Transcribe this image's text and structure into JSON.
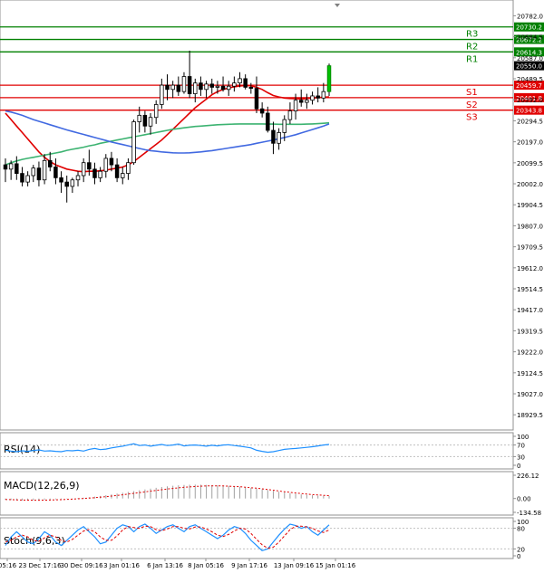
{
  "chart_data": [
    {
      "type": "candlestick",
      "panel": "price",
      "y_ticks": [
        "20782.0",
        "20684.5",
        "20587.0",
        "20489.5",
        "20392.0",
        "20294.5",
        "20197.0",
        "20099.5",
        "20002.0",
        "19904.5",
        "19807.0",
        "19709.5",
        "19612.0",
        "19514.5",
        "19417.0",
        "19319.5",
        "19222.0",
        "19124.5",
        "19027.0",
        "18929.5"
      ],
      "ylim": [
        18880,
        20830
      ],
      "x_ticks": [
        "05:16",
        "23 Dec 17:16",
        "30 Dec 09:16",
        "3 Jan 01:16",
        "6 Jan 13:16",
        "8 Jan 05:16",
        "9 Jan 17:16",
        "13 Jan 09:16",
        "15 Jan 01:16"
      ],
      "levels": [
        {
          "label": "R3",
          "value": 20730.2,
          "price_label": "20730.2",
          "color": "#008000"
        },
        {
          "label": "R2",
          "value": 20672.2,
          "price_label": "20672.2",
          "color": "#008000"
        },
        {
          "label": "R1",
          "value": 20614.3,
          "price_label": "20614.3",
          "color": "#008000"
        },
        {
          "label": "S1",
          "value": 20459.7,
          "price_label": "20459.7",
          "color": "#e00000"
        },
        {
          "label": "S2",
          "value": 20401.8,
          "price_label": "20401.8",
          "color": "#e00000"
        },
        {
          "label": "S3",
          "value": 20343.8,
          "price_label": "20343.8",
          "color": "#e00000"
        }
      ],
      "current_price": 20550.0,
      "current_price_label": "20550.0",
      "candles": [
        [
          20090,
          20120,
          20010,
          20070
        ],
        [
          20070,
          20110,
          20020,
          20095
        ],
        [
          20095,
          20130,
          20020,
          20050
        ],
        [
          20050,
          20080,
          19990,
          20010
        ],
        [
          20010,
          20060,
          19990,
          20040
        ],
        [
          20040,
          20090,
          20010,
          20075
        ],
        [
          20075,
          20105,
          19990,
          20020
        ],
        [
          20020,
          20140,
          20000,
          20110
        ],
        [
          20110,
          20150,
          20060,
          20080
        ],
        [
          20080,
          20120,
          20000,
          20030
        ],
        [
          20030,
          20060,
          19960,
          20010
        ],
        [
          20010,
          20040,
          19915,
          19990
        ],
        [
          19990,
          20030,
          19960,
          20020
        ],
        [
          20020,
          20060,
          19990,
          20040
        ],
        [
          20040,
          20120,
          20010,
          20100
        ],
        [
          20100,
          20160,
          20040,
          20070
        ],
        [
          20070,
          20100,
          20000,
          20030
        ],
        [
          20030,
          20080,
          20010,
          20060
        ],
        [
          20060,
          20140,
          20030,
          20120
        ],
        [
          20120,
          20150,
          20060,
          20090
        ],
        [
          20090,
          20120,
          20010,
          20030
        ],
        [
          20030,
          20080,
          20000,
          20050
        ],
        [
          20050,
          20120,
          20020,
          20100
        ],
        [
          20100,
          20300,
          20090,
          20290
        ],
        [
          20290,
          20360,
          20240,
          20320
        ],
        [
          20320,
          20340,
          20240,
          20270
        ],
        [
          20270,
          20330,
          20230,
          20310
        ],
        [
          20310,
          20390,
          20280,
          20370
        ],
        [
          20370,
          20490,
          20350,
          20460
        ],
        [
          20460,
          20510,
          20390,
          20440
        ],
        [
          20440,
          20480,
          20400,
          20460
        ],
        [
          20460,
          20500,
          20410,
          20430
        ],
        [
          20430,
          20520,
          20420,
          20500
        ],
        [
          20500,
          20620,
          20400,
          20420
        ],
        [
          20420,
          20490,
          20380,
          20470
        ],
        [
          20470,
          20500,
          20410,
          20440
        ],
        [
          20440,
          20480,
          20400,
          20465
        ],
        [
          20465,
          20490,
          20420,
          20450
        ],
        [
          20450,
          20480,
          20420,
          20455
        ],
        [
          20455,
          20500,
          20430,
          20440
        ],
        [
          20440,
          20480,
          20410,
          20455
        ],
        [
          20455,
          20500,
          20430,
          20470
        ],
        [
          20470,
          20520,
          20450,
          20490
        ],
        [
          20490,
          20510,
          20440,
          20450
        ],
        [
          20450,
          20470,
          20420,
          20445
        ],
        [
          20445,
          20500,
          20330,
          20350
        ],
        [
          20350,
          20380,
          20310,
          20330
        ],
        [
          20330,
          20360,
          20240,
          20250
        ],
        [
          20250,
          20290,
          20140,
          20190
        ],
        [
          20190,
          20260,
          20160,
          20240
        ],
        [
          20240,
          20320,
          20200,
          20300
        ],
        [
          20300,
          20380,
          20280,
          20340
        ],
        [
          20340,
          20420,
          20300,
          20390
        ],
        [
          20390,
          20440,
          20360,
          20380
        ],
        [
          20380,
          20420,
          20350,
          20390
        ],
        [
          20390,
          20430,
          20370,
          20410
        ],
        [
          20410,
          20450,
          20380,
          20400
        ],
        [
          20400,
          20470,
          20380,
          20430
        ],
        [
          20430,
          20560,
          20410,
          20550
        ]
      ],
      "ma_series": [
        {
          "color": "#e00000",
          "values": [
            20330,
            20300,
            20270,
            20240,
            20210,
            20180,
            20150,
            20125,
            20105,
            20090,
            20080,
            20070,
            20065,
            20060,
            20058,
            20060,
            20060,
            20062,
            20065,
            20070,
            20075,
            20080,
            20090,
            20105,
            20125,
            20145,
            20165,
            20185,
            20205,
            20230,
            20255,
            20280,
            20305,
            20330,
            20355,
            20375,
            20395,
            20415,
            20430,
            20440,
            20447,
            20452,
            20456,
            20458,
            20457,
            20450,
            20440,
            20425,
            20412,
            20405,
            20400,
            20398,
            20397,
            20396,
            20398,
            20400,
            20402,
            20404,
            20405
          ]
        },
        {
          "color": "#3cb371",
          "values": [
            20090,
            20100,
            20108,
            20115,
            20120,
            20125,
            20130,
            20135,
            20140,
            20145,
            20150,
            20157,
            20162,
            20167,
            20172,
            20178,
            20183,
            20190,
            20195,
            20200,
            20205,
            20210,
            20215,
            20220,
            20225,
            20230,
            20235,
            20240,
            20245,
            20250,
            20255,
            20258,
            20262,
            20265,
            20268,
            20270,
            20272,
            20274,
            20276,
            20277,
            20278,
            20279,
            20280,
            20280,
            20280,
            20280,
            20280,
            20279,
            20279,
            20278,
            20278,
            20278,
            20278,
            20278,
            20279,
            20280,
            20281,
            20283,
            20285
          ]
        },
        {
          "color": "#4169e1",
          "values": [
            20340,
            20335,
            20328,
            20320,
            20310,
            20300,
            20292,
            20284,
            20276,
            20268,
            20260,
            20252,
            20245,
            20238,
            20231,
            20224,
            20217,
            20210,
            20203,
            20196,
            20190,
            20184,
            20178,
            20172,
            20166,
            20160,
            20156,
            20153,
            20150,
            20148,
            20146,
            20145,
            20145,
            20146,
            20148,
            20150,
            20153,
            20156,
            20160,
            20164,
            20168,
            20172,
            20176,
            20180,
            20184,
            20190,
            20195,
            20200,
            20205,
            20211,
            20217,
            20223,
            20230,
            20238,
            20246,
            20254,
            20262,
            20270,
            20280
          ]
        }
      ]
    },
    {
      "type": "line",
      "panel": "rsi",
      "title": "RSI(14)",
      "y_ticks": [
        "100",
        "70",
        "30",
        "0"
      ],
      "ylim": [
        0,
        100
      ],
      "line_color": "#1e90ff",
      "values": [
        52,
        49,
        47,
        50,
        48,
        51,
        53,
        49,
        50,
        48,
        47,
        51,
        50,
        52,
        49,
        55,
        58,
        54,
        56,
        60,
        63,
        66,
        70,
        74,
        68,
        70,
        66,
        69,
        72,
        68,
        70,
        73,
        67,
        69,
        70,
        68,
        66,
        69,
        67,
        70,
        71,
        68,
        66,
        63,
        60,
        52,
        48,
        45,
        47,
        51,
        55,
        57,
        58,
        60,
        62,
        64,
        67,
        70,
        72
      ]
    },
    {
      "type": "bar",
      "panel": "macd",
      "title": "MACD(12,26,9)",
      "y_ticks": [
        "226.12",
        "0.00",
        "-134.58"
      ],
      "ylim": [
        -134.58,
        226.12
      ],
      "histogram": [
        -12,
        -15,
        -18,
        -20,
        -20,
        -18,
        -15,
        -12,
        -10,
        -8,
        -5,
        -2,
        2,
        5,
        8,
        12,
        18,
        25,
        32,
        40,
        48,
        56,
        64,
        72,
        80,
        88,
        96,
        104,
        112,
        118,
        124,
        128,
        132,
        134,
        135,
        134,
        132,
        130,
        128,
        125,
        122,
        118,
        114,
        110,
        104,
        98,
        90,
        82,
        74,
        66,
        58,
        52,
        46,
        40,
        36,
        32,
        28,
        26,
        24
      ],
      "signal": [
        -10,
        -11,
        -13,
        -15,
        -16,
        -17,
        -17,
        -16,
        -15,
        -13,
        -11,
        -9,
        -6,
        -3,
        0,
        4,
        8,
        13,
        18,
        24,
        30,
        36,
        43,
        50,
        57,
        64,
        71,
        78,
        85,
        92,
        98,
        104,
        109,
        113,
        117,
        120,
        122,
        123,
        123,
        122,
        120,
        117,
        114,
        110,
        105,
        100,
        94,
        87,
        80,
        73,
        66,
        60,
        54,
        48,
        43,
        38,
        34,
        31,
        28
      ],
      "signal_color": "#e00000",
      "histogram_color": "#a0a0a0"
    },
    {
      "type": "line",
      "panel": "stoch",
      "title": "Stoch(9,6,3)",
      "y_ticks": [
        "100",
        "80",
        "20",
        "0"
      ],
      "ylim": [
        0,
        100
      ],
      "main": [
        30,
        55,
        70,
        55,
        40,
        35,
        50,
        70,
        60,
        40,
        30,
        45,
        60,
        75,
        85,
        70,
        55,
        35,
        40,
        60,
        80,
        90,
        85,
        70,
        85,
        92,
        80,
        65,
        75,
        85,
        90,
        80,
        70,
        85,
        90,
        80,
        70,
        60,
        50,
        60,
        75,
        85,
        80,
        65,
        45,
        30,
        15,
        20,
        40,
        60,
        78,
        92,
        88,
        80,
        85,
        70,
        60,
        75,
        90
      ],
      "signal": [
        40,
        45,
        55,
        60,
        55,
        45,
        42,
        52,
        60,
        55,
        45,
        40,
        48,
        60,
        72,
        76,
        70,
        55,
        45,
        45,
        58,
        75,
        85,
        82,
        80,
        86,
        85,
        76,
        73,
        78,
        85,
        85,
        80,
        78,
        84,
        84,
        78,
        70,
        60,
        56,
        62,
        72,
        80,
        78,
        65,
        48,
        32,
        22,
        25,
        40,
        58,
        76,
        86,
        86,
        84,
        80,
        72,
        68,
        75
      ],
      "main_color": "#1e90ff",
      "signal_color": "#e00000"
    }
  ]
}
